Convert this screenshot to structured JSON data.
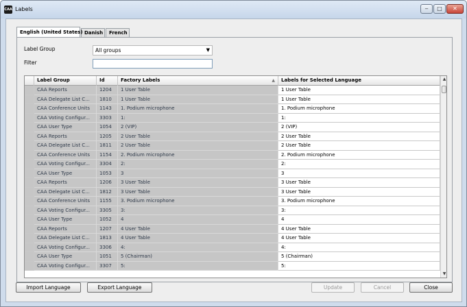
{
  "window": {
    "title": "Labels",
    "icon_text": "CAA"
  },
  "tabs": [
    {
      "label": "English (United States)"
    },
    {
      "label": "Danish"
    },
    {
      "label": "French"
    }
  ],
  "form": {
    "label_group_label": "Label Group",
    "label_group_value": "All groups",
    "filter_label": "Filter",
    "filter_value": ""
  },
  "table": {
    "headers": {
      "group": "Label Group",
      "id": "Id",
      "factory": "Factory Labels",
      "selected": "Labels for Selected Language"
    },
    "rows": [
      {
        "group": "CAA Reports",
        "id": "1204",
        "factory": "1 User Table",
        "label": "1 User Table"
      },
      {
        "group": "CAA Delegate List C...",
        "id": "1810",
        "factory": "1 User Table",
        "label": "1 User Table"
      },
      {
        "group": "CAA Conference Units",
        "id": "1143",
        "factory": "1. Podium microphone",
        "label": "1. Podium microphone"
      },
      {
        "group": "CAA Voting Configur...",
        "id": "3303",
        "factory": "1:",
        "label": "1:"
      },
      {
        "group": "CAA User Type",
        "id": "1054",
        "factory": "2 (VIP)",
        "label": "2 (VIP)"
      },
      {
        "group": "CAA Reports",
        "id": "1205",
        "factory": "2 User Table",
        "label": "2 User Table"
      },
      {
        "group": "CAA Delegate List C...",
        "id": "1811",
        "factory": "2 User Table",
        "label": "2 User Table"
      },
      {
        "group": "CAA Conference Units",
        "id": "1154",
        "factory": "2. Podium microphone",
        "label": "2. Podium microphone"
      },
      {
        "group": "CAA Voting Configur...",
        "id": "3304",
        "factory": "2:",
        "label": "2:"
      },
      {
        "group": "CAA User Type",
        "id": "1053",
        "factory": "3",
        "label": "3"
      },
      {
        "group": "CAA Reports",
        "id": "1206",
        "factory": "3 User Table",
        "label": "3 User Table"
      },
      {
        "group": "CAA Delegate List C...",
        "id": "1812",
        "factory": "3 User Table",
        "label": "3 User Table"
      },
      {
        "group": "CAA Conference Units",
        "id": "1155",
        "factory": "3. Podium microphone",
        "label": "3. Podium microphone"
      },
      {
        "group": "CAA Voting Configur...",
        "id": "3305",
        "factory": "3:",
        "label": "3:"
      },
      {
        "group": "CAA User Type",
        "id": "1052",
        "factory": "4",
        "label": "4"
      },
      {
        "group": "CAA Reports",
        "id": "1207",
        "factory": "4 User Table",
        "label": "4 User Table"
      },
      {
        "group": "CAA Delegate List C...",
        "id": "1813",
        "factory": "4 User Table",
        "label": "4 User Table"
      },
      {
        "group": "CAA Voting Configur...",
        "id": "3306",
        "factory": "4:",
        "label": "4:"
      },
      {
        "group": "CAA User Type",
        "id": "1051",
        "factory": "5 (Chairman)",
        "label": "5 (Chairman)"
      },
      {
        "group": "CAA Voting Configur...",
        "id": "3307",
        "factory": "5:",
        "label": "5:"
      }
    ]
  },
  "buttons": {
    "import": "Import Language",
    "export": "Export Language",
    "update": "Update",
    "cancel": "Cancel",
    "close": "Close"
  }
}
